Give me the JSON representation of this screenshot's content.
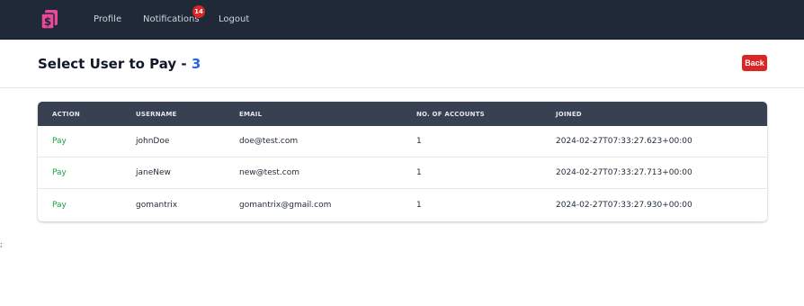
{
  "nav": {
    "logo_icon": "dollar-document-logo-icon",
    "profile": "Profile",
    "notifications": "Notifications",
    "notifications_count": "14",
    "logout": "Logout"
  },
  "page": {
    "title": "Select User to Pay -",
    "count": "3",
    "back_label": "Back"
  },
  "table": {
    "headers": [
      "ACTION",
      "USERNAME",
      "EMAIL",
      "NO. OF ACCOUNTS",
      "JOINED"
    ],
    "rows": [
      {
        "action": "Pay",
        "username": "johnDoe",
        "email": "doe@test.com",
        "accounts": "1",
        "joined": "2024-02-27T07:33:27.623+00:00"
      },
      {
        "action": "Pay",
        "username": "janeNew",
        "email": "new@test.com",
        "accounts": "1",
        "joined": "2024-02-27T07:33:27.713+00:00"
      },
      {
        "action": "Pay",
        "username": "gomantrix",
        "email": "gomantrix@gmail.com",
        "accounts": "1",
        "joined": "2024-02-27T07:33:27.930+00:00"
      }
    ]
  },
  "stray_text": ";",
  "colors": {
    "navbar": "#1f2937",
    "accent_blue": "#2563eb",
    "danger_red": "#dc2626",
    "pay_green": "#16a34a",
    "logo_pink": "#ec4899"
  }
}
